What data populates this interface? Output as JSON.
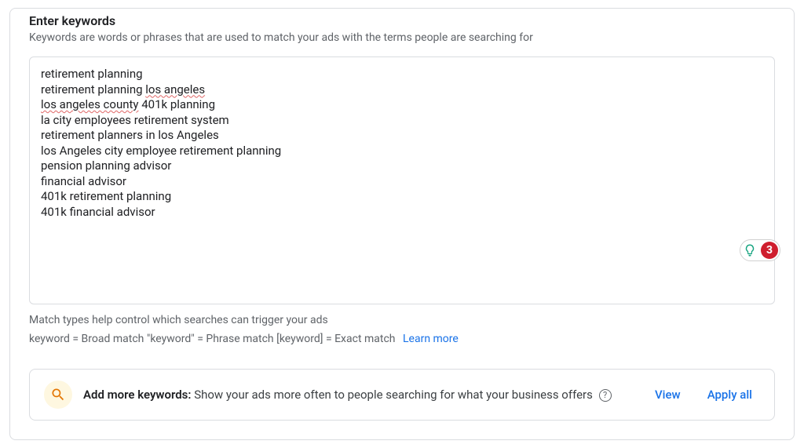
{
  "heading": "Enter keywords",
  "subheading": "Keywords are words or phrases that are used to match your ads with the terms people are searching for",
  "keywords_lines": [
    "retirement planning",
    "retirement planning los angeles",
    "los angeles county 401k planning",
    "la city employees retirement system",
    "retirement planners in los Angeles",
    "los Angeles city employee retirement planning",
    "pension planning advisor",
    "financial advisor",
    "401k retirement planning",
    "401k financial advisor"
  ],
  "spellcheck_underline_rules": [
    {
      "line": 1,
      "substring": "los angeles"
    },
    {
      "line": 2,
      "substring": "los angeles county"
    }
  ],
  "widget": {
    "count": "3"
  },
  "match_types_line1": "Match types help control which searches can trigger your ads",
  "match_types_line2": "keyword = Broad match   \"keyword\" = Phrase match   [keyword] = Exact match",
  "learn_more_label": "Learn more",
  "suggestion": {
    "bold": "Add more keywords:",
    "rest": " Show your ads more often to people searching for what your business offers "
  },
  "view_label": "View",
  "apply_all_label": "Apply all"
}
